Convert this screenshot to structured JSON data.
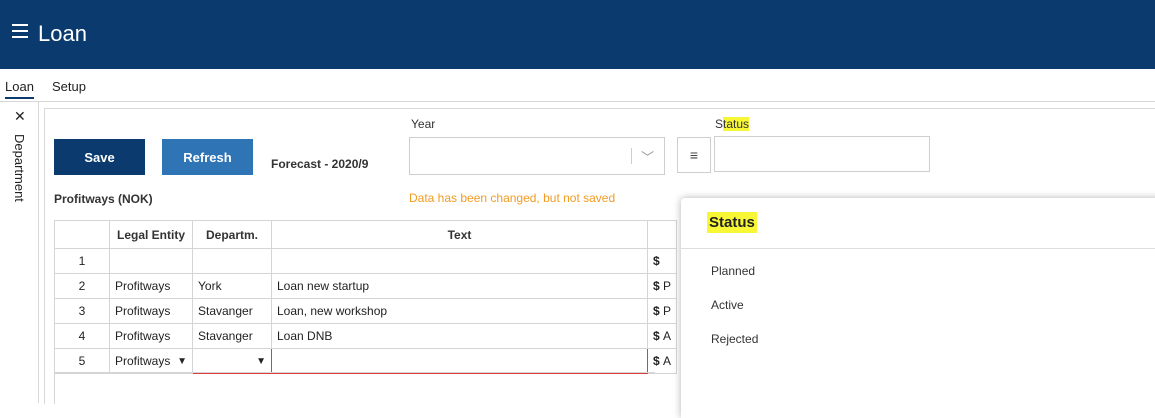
{
  "header": {
    "title": "Loan"
  },
  "menu": {
    "items": [
      {
        "label": "Loan"
      },
      {
        "label": "Setup"
      }
    ]
  },
  "sidebar": {
    "label": "Department"
  },
  "toolbar": {
    "save_label": "Save",
    "refresh_label": "Refresh",
    "forecast_label": "Forecast - 2020/9",
    "year_label": "Year",
    "year_value": "",
    "status_label_prefix": "S",
    "status_label_highlight": "tatus",
    "status_value": ""
  },
  "company_label": "Profitways (NOK)",
  "warning": "Data has been changed, but not saved",
  "grid": {
    "columns": [
      "",
      "Legal Entity",
      "Departm.",
      "Text",
      ""
    ],
    "rows": [
      {
        "num": "1",
        "entity": "",
        "dept": "",
        "text": "",
        "cur": "$",
        "extra": ""
      },
      {
        "num": "2",
        "entity": "Profitways",
        "dept": "York",
        "text": "Loan new startup",
        "cur": "$",
        "extra": "P"
      },
      {
        "num": "3",
        "entity": "Profitways",
        "dept": "Stavanger",
        "text": "Loan, new workshop",
        "cur": "$",
        "extra": "P"
      },
      {
        "num": "4",
        "entity": "Profitways",
        "dept": "Stavanger",
        "text": "Loan DNB",
        "cur": "$",
        "extra": "A"
      },
      {
        "num": "5",
        "entity": "Profitways",
        "dept": "",
        "text": "",
        "cur": "$",
        "extra": "A"
      }
    ]
  },
  "status_popup": {
    "title": "Status",
    "options": [
      "Planned",
      "Active",
      "Rejected"
    ]
  },
  "colors": {
    "brand": "#0b3a6e",
    "refresh": "#2f74b5",
    "warning": "#f29b23",
    "highlight": "#f7f736",
    "error": "#e23d3d"
  },
  "icons": {
    "menu": "hamburger-icon",
    "pin": "pin-off-icon",
    "chevron": "chevron-down-icon",
    "list": "list-icon"
  }
}
